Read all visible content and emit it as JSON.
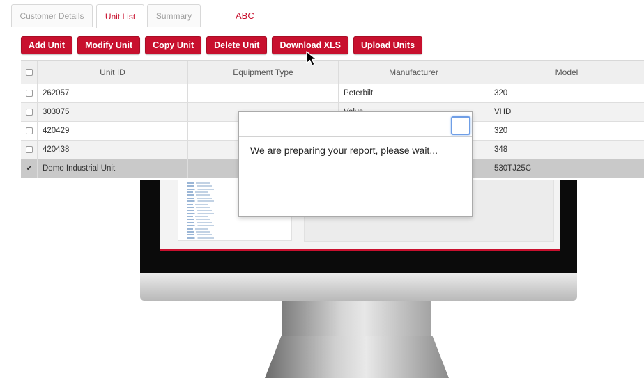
{
  "tabs": [
    {
      "label": "Customer Details"
    },
    {
      "label": "Unit List"
    },
    {
      "label": "Summary"
    }
  ],
  "page_title": "ABC",
  "toolbar": {
    "buttons": [
      "Add Unit",
      "Modify Unit",
      "Copy Unit",
      "Delete Unit",
      "Download XLS",
      "Upload Units"
    ]
  },
  "table": {
    "columns": [
      "Unit ID",
      "Equipment Type",
      "Manufacturer",
      "Model"
    ],
    "rows": [
      {
        "unit_id": "262057",
        "equipment_type": "",
        "manufacturer": "Peterbilt",
        "model": "320",
        "checked": false
      },
      {
        "unit_id": "303075",
        "equipment_type": "",
        "manufacturer": "Volvo",
        "model": "VHD",
        "checked": false
      },
      {
        "unit_id": "420429",
        "equipment_type": "",
        "manufacturer": "",
        "model": "320",
        "checked": false
      },
      {
        "unit_id": "420438",
        "equipment_type": "",
        "manufacturer": "",
        "model": "348",
        "checked": false
      },
      {
        "unit_id": "Demo Industrial Unit",
        "equipment_type": "",
        "manufacturer": "",
        "model": "530TJ25C",
        "checked": true
      }
    ],
    "checked_mark": "✔"
  },
  "dialog": {
    "message": "We are preparing your report, please wait..."
  },
  "colors": {
    "accent": "#c8102e",
    "selected_row": "#c9c9c9",
    "focus": "#6f9ee6"
  },
  "icons": {
    "cursor": "arrow-cursor-icon",
    "checkbox": "checkbox-icon",
    "close": "dialog-close-button"
  }
}
